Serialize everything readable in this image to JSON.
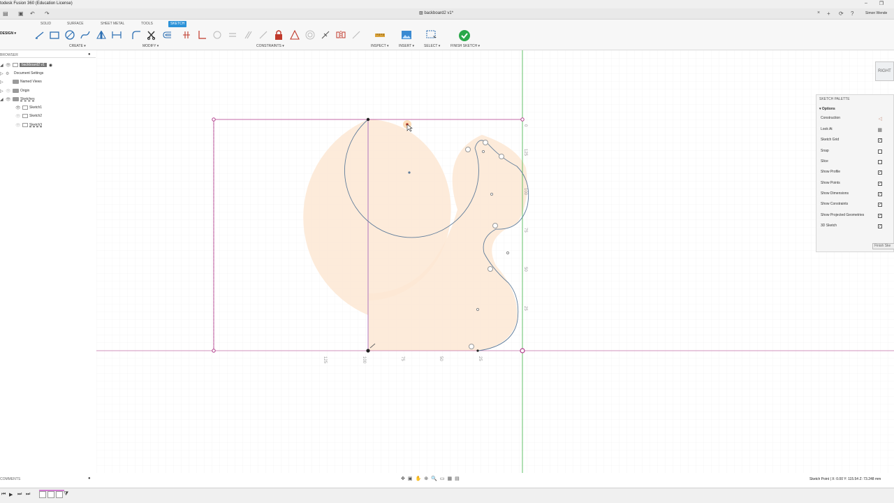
{
  "app": {
    "title": "todesk Fusion 360 (Education License)",
    "document_tab": "backboard2 v1*",
    "user": "Simon Wende"
  },
  "workspace_tabs": [
    "SOLID",
    "SURFACE",
    "SHEET METAL",
    "TOOLS",
    "SKETCH"
  ],
  "design_label": "DESIGN ▾",
  "toolbar_groups": {
    "create": "CREATE ▾",
    "modify": "MODIFY ▾",
    "constraints": "CONSTRAINTS ▾",
    "inspect": "INSPECT ▾",
    "insert": "INSERT ▾",
    "select": "SELECT ▾",
    "finish": "FINISH SKETCH ▾"
  },
  "browser": {
    "header": "BROWSER",
    "root": "backboard2 v1",
    "items": [
      "Document Settings",
      "Named Views",
      "Origin",
      "Sketches"
    ],
    "sketches": [
      "Sketch1",
      "Sketch2",
      "Sketch3"
    ]
  },
  "viewcube": {
    "face": "RIGHT"
  },
  "palette": {
    "title": "SKETCH PALETTE",
    "section": "Options",
    "options": [
      {
        "label": "Construction",
        "type": "icon"
      },
      {
        "label": "Look At",
        "type": "icon"
      },
      {
        "label": "Sketch Grid",
        "type": "check",
        "checked": true
      },
      {
        "label": "Snap",
        "type": "check",
        "checked": false
      },
      {
        "label": "Slice",
        "type": "check",
        "checked": false
      },
      {
        "label": "Show Profile",
        "type": "check",
        "checked": true
      },
      {
        "label": "Show Points",
        "type": "check",
        "checked": true
      },
      {
        "label": "Show Dimensions",
        "type": "check",
        "checked": true
      },
      {
        "label": "Show Constraints",
        "type": "check",
        "checked": true
      },
      {
        "label": "Show Projected Geometries",
        "type": "check",
        "checked": true
      },
      {
        "label": "3D Sketch",
        "type": "check",
        "checked": true
      }
    ],
    "finish_button": "Finish Ske"
  },
  "comments_label": "COMMENTS",
  "status": "Sketch Point | X: 0.00 Y: 115.54 Z: 73.248 mm",
  "axis_labels": {
    "horizontal": [
      "125",
      "100",
      "75",
      "50",
      "25"
    ],
    "vertical": [
      "0",
      "125",
      "100",
      "75",
      "50",
      "25"
    ]
  },
  "colors": {
    "accent": "#2c92d8",
    "profile_fill": "#fde7d3",
    "sketch_line": "#5f7c9a",
    "construction": "#b03a8a",
    "axis_green": "#3cb043",
    "finish_green": "#2aa84a"
  }
}
